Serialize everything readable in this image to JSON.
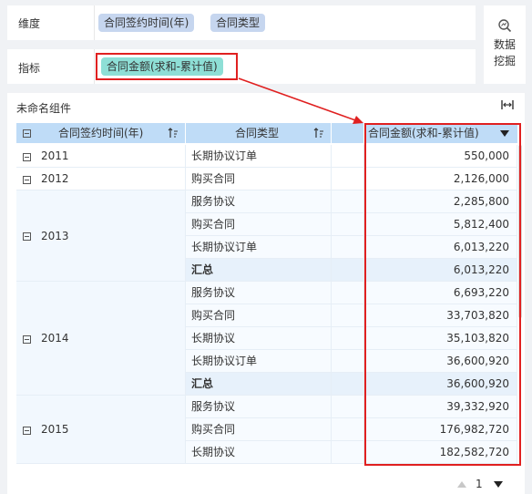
{
  "dimension_row": {
    "label": "维度",
    "pills": [
      "合同签约时间(年)",
      "合同类型"
    ]
  },
  "metric_row": {
    "label": "指标",
    "pill": "合同金额(求和-累计值)"
  },
  "mining_button": {
    "line1": "数据",
    "line2": "挖掘",
    "icon": "magnify-chart-icon"
  },
  "component": {
    "title": "未命名组件"
  },
  "table": {
    "headers": {
      "year": "合同签约时间(年)",
      "type": "合同类型",
      "amount": "合同金额(求和-累计值)"
    },
    "groups": [
      {
        "year": "2011",
        "rows": [
          {
            "type": "长期协议订单",
            "amount": "550,000"
          }
        ]
      },
      {
        "year": "2012",
        "rows": [
          {
            "type": "购买合同",
            "amount": "2,126,000"
          }
        ]
      },
      {
        "year": "2013",
        "rows": [
          {
            "type": "服务协议",
            "amount": "2,285,800"
          },
          {
            "type": "购买合同",
            "amount": "5,812,400"
          },
          {
            "type": "长期协议订单",
            "amount": "6,013,220"
          },
          {
            "type": "汇总",
            "amount": "6,013,220",
            "subtotal": true
          }
        ]
      },
      {
        "year": "2014",
        "rows": [
          {
            "type": "服务协议",
            "amount": "6,693,220"
          },
          {
            "type": "购买合同",
            "amount": "33,703,820"
          },
          {
            "type": "长期协议",
            "amount": "35,103,820"
          },
          {
            "type": "长期协议订单",
            "amount": "36,600,920"
          },
          {
            "type": "汇总",
            "amount": "36,600,920",
            "subtotal": true
          }
        ]
      },
      {
        "year": "2015",
        "rows": [
          {
            "type": "服务协议",
            "amount": "39,332,920"
          },
          {
            "type": "购买合同",
            "amount": "176,982,720"
          },
          {
            "type": "长期协议",
            "amount": "182,582,720"
          }
        ]
      }
    ]
  },
  "pagination": {
    "page": "1"
  },
  "colors": {
    "highlight": "#e02020",
    "header": "#bfdcf7",
    "metric_pill": "#8edfd6",
    "dimension_pill": "#c6d6ef"
  }
}
